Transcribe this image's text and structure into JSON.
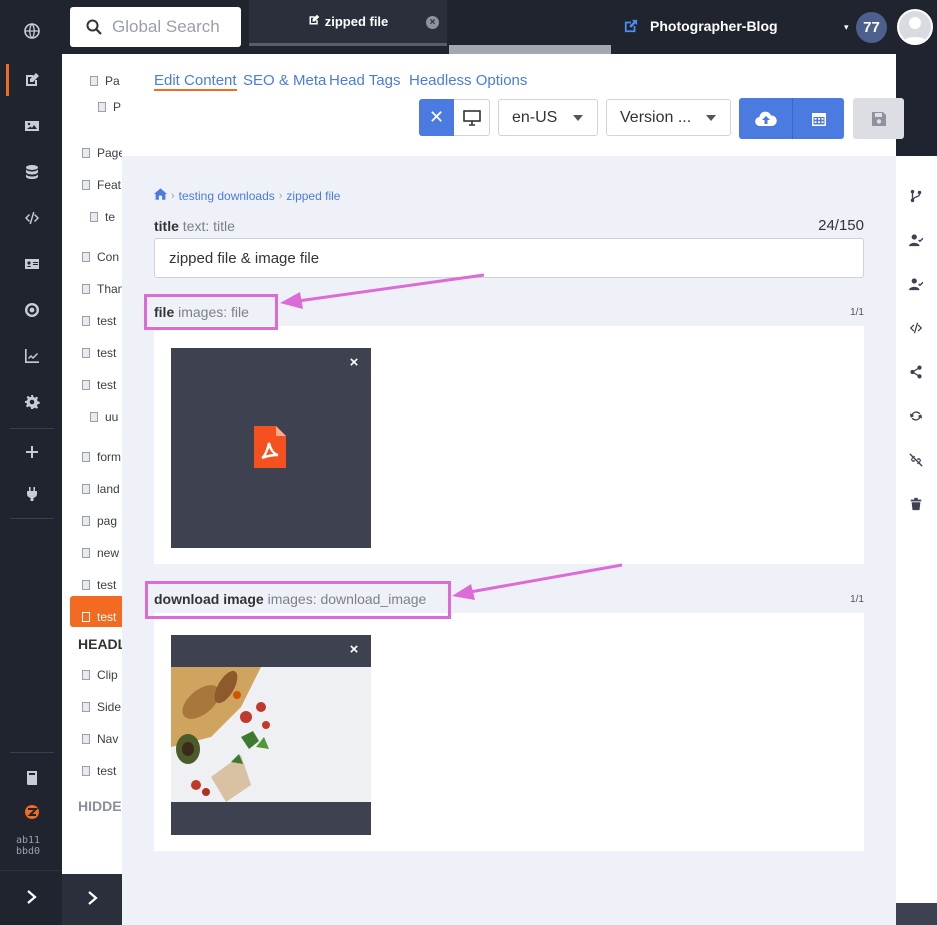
{
  "topbar": {
    "search_placeholder": "Global Search",
    "tab_title": "zipped file",
    "tab_close": "×",
    "site_name": "Photographer-Blog",
    "site_caret": "▾",
    "notification_count": "77"
  },
  "tree": {
    "items": [
      "Pa",
      "P",
      "Page",
      "Feat",
      "te",
      "Con",
      "Than",
      "test",
      "test",
      "test",
      "uu",
      "form",
      "land",
      "pag",
      "new",
      "test",
      "test"
    ],
    "section_headless": "HEADL",
    "headless_items": [
      "Clip",
      "Side",
      "Nav",
      "test"
    ],
    "section_hidden": "HIDDE"
  },
  "rail": {
    "hash_line1": "ab11",
    "hash_line2": "bbd0"
  },
  "editor": {
    "tabs": [
      "Edit Content",
      "SEO & Meta",
      "Head Tags",
      "Headless Options"
    ],
    "language": "en-US",
    "version": "Version ...",
    "breadcrumb": [
      "testing downloads",
      "zipped file"
    ],
    "title_field": {
      "name": "title",
      "type": "text: title",
      "value": "zipped file & image file",
      "count": "24/150"
    },
    "file_field": {
      "name": "file",
      "type": "images: file",
      "count": "1/1"
    },
    "download_field": {
      "name": "download image",
      "type": "images: download_image",
      "count": "1/1"
    },
    "thumb_close": "×"
  },
  "colors": {
    "accent": "#4b7be0",
    "brand_orange": "#f26b21",
    "annotation": "#dd6bd7",
    "dark_bg": "#20242f"
  },
  "icons": [
    "globe-icon",
    "edit-icon",
    "image-icon",
    "database-icon",
    "code-icon",
    "id-card-icon",
    "target-icon",
    "chart-icon",
    "gear-icon",
    "plus-icon",
    "plug-icon",
    "book-icon",
    "zesty-logo-icon",
    "chevron-right-icon",
    "search-icon",
    "external-link-icon",
    "home-icon",
    "pdf-icon",
    "cloud-upload-icon",
    "calendar-icon",
    "save-icon",
    "desktop-icon",
    "close-icon",
    "branch-icon",
    "user-check-icon",
    "share-icon",
    "sync-icon",
    "unlink-icon",
    "trash-icon"
  ]
}
